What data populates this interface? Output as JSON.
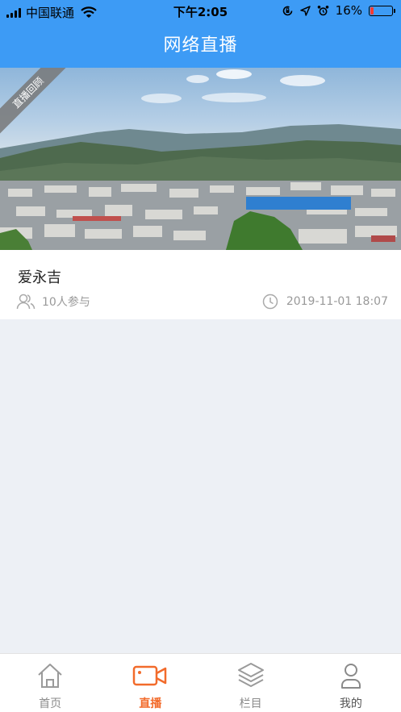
{
  "status_bar": {
    "carrier": "中国联通",
    "time": "下午2:05",
    "battery_percent": "16%",
    "battery_level": 0.16,
    "icons": [
      "signal-icon",
      "wifi-icon",
      "orientation-lock-icon",
      "location-icon",
      "alarm-icon",
      "battery-icon"
    ]
  },
  "nav": {
    "title": "网络直播"
  },
  "live_list": [
    {
      "badge": "直播回顾",
      "title": "爱永吉",
      "participants": "10人参与",
      "datetime": "2019-11-01 18:07"
    }
  ],
  "tabbar": {
    "items": [
      {
        "label": "首页",
        "icon": "home-icon",
        "active": false
      },
      {
        "label": "直播",
        "icon": "video-camera-icon",
        "active": true
      },
      {
        "label": "栏目",
        "icon": "layers-icon",
        "active": false
      },
      {
        "label": "我的",
        "icon": "user-icon",
        "active": false
      }
    ]
  },
  "colors": {
    "accent": "#3d9bf5",
    "active_tab": "#f26b2b"
  }
}
